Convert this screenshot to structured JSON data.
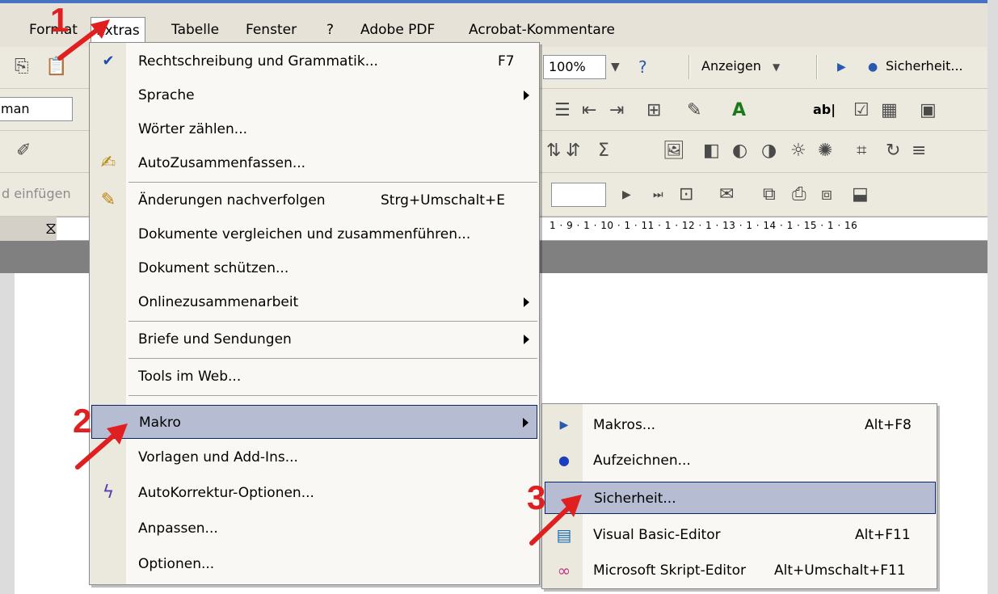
{
  "menubar": {
    "items": [
      {
        "label": "Format"
      },
      {
        "label": "Extras"
      },
      {
        "label": "Tabelle"
      },
      {
        "label": "Fenster"
      },
      {
        "label": "?"
      },
      {
        "label": "Adobe PDF"
      },
      {
        "label": "Acrobat-Kommentare"
      }
    ]
  },
  "toolbar": {
    "zoom_value": "100%",
    "anzeigen_label": "Anzeigen",
    "sicherheit_label": "Sicherheit...",
    "font_partial": "man",
    "einfuegen_partial": "d einfügen"
  },
  "ruler": {
    "text": "1 · 9 · 1 · 10 · 1 · 11 · 1 · 12 · 1 · 13 · 1 · 14 · 1 · 15 · 1 · 16"
  },
  "extras_menu": {
    "items": [
      {
        "label": "Rechtschreibung und Grammatik...",
        "shortcut": "F7",
        "icon": "spellcheck-icon"
      },
      {
        "label": "Sprache",
        "submenu": true
      },
      {
        "label": "Wörter zählen..."
      },
      {
        "label": "AutoZusammenfassen...",
        "icon": "autosummary-icon"
      },
      {
        "label": "Änderungen nachverfolgen",
        "shortcut": "Strg+Umschalt+E",
        "icon": "track-changes-icon"
      },
      {
        "label": "Dokumente vergleichen und zusammenführen..."
      },
      {
        "label": "Dokument schützen..."
      },
      {
        "label": "Onlinezusammenarbeit",
        "submenu": true
      },
      {
        "label": "Briefe und Sendungen",
        "submenu": true
      },
      {
        "label": "Tools im Web..."
      },
      {
        "label": "Makro",
        "submenu": true,
        "highlighted": true
      },
      {
        "label": "Vorlagen und Add-Ins..."
      },
      {
        "label": "AutoKorrektur-Optionen...",
        "icon": "autocorrect-icon"
      },
      {
        "label": "Anpassen..."
      },
      {
        "label": "Optionen..."
      }
    ]
  },
  "makro_menu": {
    "items": [
      {
        "label": "Makros...",
        "shortcut": "Alt+F8",
        "icon": "play-icon"
      },
      {
        "label": "Aufzeichnen...",
        "icon": "record-icon"
      },
      {
        "label": "Sicherheit...",
        "highlighted": true
      },
      {
        "label": "Visual Basic-Editor",
        "shortcut": "Alt+F11",
        "icon": "vb-editor-icon"
      },
      {
        "label": "Microsoft Skript-Editor",
        "shortcut": "Alt+Umschalt+F11",
        "icon": "script-editor-icon"
      }
    ]
  },
  "annotations": {
    "step1": "1",
    "step2": "2",
    "step3": "3",
    "arrow_color": "#e02020"
  },
  "colors": {
    "highlight": "#b6bdd2",
    "highlight_border": "#0a246a",
    "menubar_bg": "#e6e2d7"
  }
}
